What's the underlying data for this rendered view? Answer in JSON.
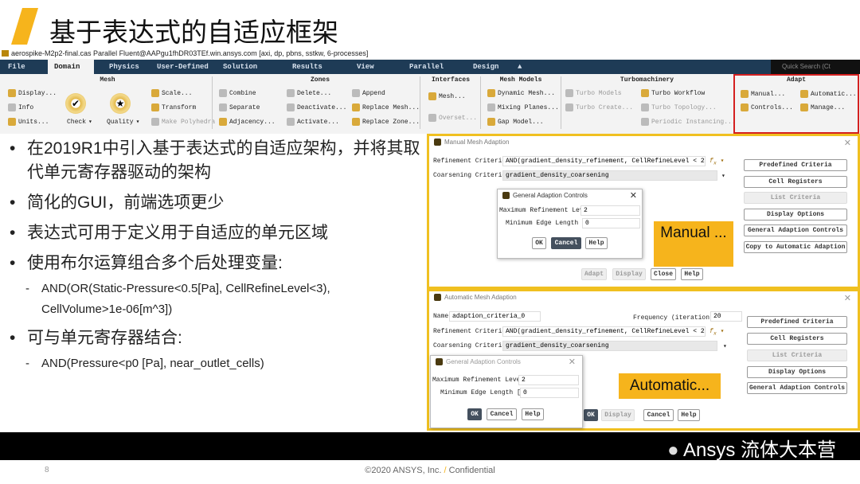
{
  "slide": {
    "title": "基于表达式的自适应框架",
    "page_number": "8",
    "copyright": "©2020 ANSYS, Inc.",
    "separator": "/",
    "confidential": "Confidential",
    "watermark": "Ansys 流体大本营",
    "accent": "#f6b41c"
  },
  "window": {
    "title": "aerospike-M2p2-final.cas Parallel Fluent@AAPgu1fhDR03TEf.win.ansys.com  [axi, dp, pbns, sstkw, 6-processes]",
    "tabs": [
      "File",
      "Domain",
      "Physics",
      "User-Defined",
      "Solution",
      "Results",
      "View",
      "Parallel",
      "Design"
    ],
    "active_tab": "Domain",
    "collapse": "▲",
    "quick_search": "Quick Search (Ct"
  },
  "ribbon": {
    "mesh": {
      "title": "Mesh",
      "display": "Display...",
      "info": "Info",
      "units": "Units...",
      "check": "Check",
      "quality": "Quality",
      "scale": "Scale...",
      "transform": "Transform",
      "make_polyhedra": "Make Polyhedra"
    },
    "zones": {
      "title": "Zones",
      "combine": "Combine",
      "separate": "Separate",
      "adjacency": "Adjacency...",
      "delete": "Delete...",
      "deactivate": "Deactivate...",
      "activate": "Activate...",
      "append": "Append",
      "replace_mesh": "Replace Mesh...",
      "replace_zone": "Replace Zone..."
    },
    "interfaces": {
      "title": "Interfaces",
      "mesh": "Mesh...",
      "overset": "Overset..."
    },
    "mesh_models": {
      "title": "Mesh Models",
      "dynamic": "Dynamic Mesh...",
      "mixing": "Mixing Planes...",
      "gap": "Gap Model..."
    },
    "turbo": {
      "title": "Turbomachinery",
      "models": "Turbo Models",
      "create": "Turbo Create...",
      "workflow": "Turbo Workflow",
      "topology": "Turbo Topology...",
      "periodic": "Periodic Instancing..."
    },
    "adapt": {
      "title": "Adapt",
      "manual": "Manual...",
      "automatic": "Automatic...",
      "controls": "Controls...",
      "manage": "Manage..."
    }
  },
  "bullets": [
    {
      "text": "在2019R1中引入基于表达式的自适应架构，并将其取代单元寄存器驱动的架构"
    },
    {
      "text": "简化的GUI，前端选项更少"
    },
    {
      "text": "表达式可用于定义用于自适应的单元区域"
    },
    {
      "text": "使用布尔运算组合多个后处理变量:",
      "sub": "AND(OR(Static-Pressure<0.5[Pa], CellRefineLevel<3), CellVolume>1e-06[m^3])"
    },
    {
      "text": "可与单元寄存器结合:",
      "sub": "AND(Pressure<p0 [Pa], near_outlet_cells)"
    }
  ],
  "manual": {
    "title": "Manual Mesh Adaption",
    "refine_label": "Refinement Criterion",
    "refine_value": "AND(gradient_density_refinement, CellRefineLevel < 2)",
    "coarsen_label": "Coarsening Criterion",
    "coarsen_value": "gradient_density_coarsening",
    "side": [
      "Predefined Criteria",
      "Cell Registers",
      "List Criteria",
      "Display Options",
      "General Adaption Controls",
      "Copy to Automatic Adaption"
    ],
    "bottom": [
      "Adapt",
      "Display",
      "Close",
      "Help"
    ],
    "note": "Manual ..."
  },
  "automatic": {
    "title": "Automatic Mesh Adaption",
    "name_label": "Name",
    "name_value": "adaption_criteria_0",
    "freq_label": "Frequency (iteration)",
    "freq_value": "20",
    "refine_label": "Refinement Criterion",
    "refine_value": "AND(gradient_density_refinement, CellRefineLevel < 2)",
    "coarsen_label": "Coarsening Criterion",
    "coarsen_value": "gradient_density_coarsening",
    "side": [
      "Predefined Criteria",
      "Cell Registers",
      "List Criteria",
      "Display Options",
      "General Adaption Controls"
    ],
    "bottom": [
      "OK",
      "Display",
      "Cancel",
      "Help"
    ],
    "note": "Automatic..."
  },
  "gac": {
    "title": "General Adaption Controls",
    "max_label": "Maximum Refinement Level",
    "max_value": "2",
    "min_label": "Minimum Edge Length [m]",
    "min_value": "0",
    "ok": "OK",
    "cancel": "Cancel",
    "help": "Help"
  }
}
